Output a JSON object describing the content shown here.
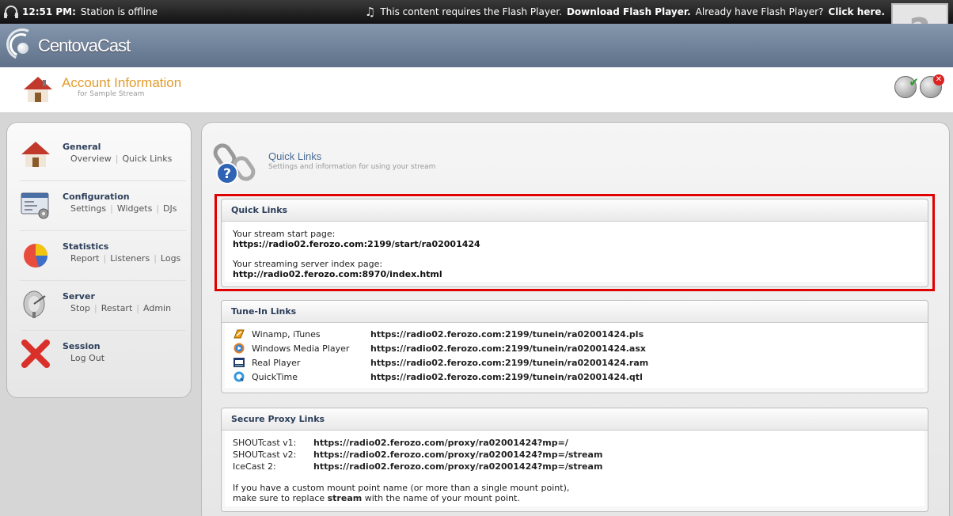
{
  "topbar": {
    "time": "12:51 PM:",
    "status": "Station is offline",
    "flash_notice": "This content requires the Flash Player.",
    "download_link": "Download Flash Player.",
    "already_text": "Already have Flash Player?",
    "click_link": "Click here.",
    "flash_placeholder": "?"
  },
  "brand": {
    "name": "CentovaCast"
  },
  "account": {
    "title": "Account Information",
    "subtitle": "for Sample Stream"
  },
  "sidebar": {
    "sections": [
      {
        "heading": "General",
        "links": [
          "Overview",
          "Quick Links"
        ]
      },
      {
        "heading": "Configuration",
        "links": [
          "Settings",
          "Widgets",
          "DJs"
        ]
      },
      {
        "heading": "Statistics",
        "links": [
          "Report",
          "Listeners",
          "Logs"
        ]
      },
      {
        "heading": "Server",
        "links": [
          "Stop",
          "Restart",
          "Admin"
        ]
      },
      {
        "heading": "Session",
        "links": [
          "Log Out"
        ]
      }
    ]
  },
  "page": {
    "title": "Quick Links",
    "subtitle": "Settings and information for using your stream"
  },
  "quick_links": {
    "heading": "Quick Links",
    "start_label": "Your stream start page:",
    "start_url": "https://radio02.ferozo.com:2199/start/ra02001424",
    "index_label": "Your streaming server index page:",
    "index_url": "http://radio02.ferozo.com:8970/index.html"
  },
  "tunein": {
    "heading": "Tune-In Links",
    "rows": [
      {
        "name": "Winamp, iTunes",
        "url": "https://radio02.ferozo.com:2199/tunein/ra02001424.pls"
      },
      {
        "name": "Windows Media Player",
        "url": "https://radio02.ferozo.com:2199/tunein/ra02001424.asx"
      },
      {
        "name": "Real Player",
        "url": "https://radio02.ferozo.com:2199/tunein/ra02001424.ram"
      },
      {
        "name": "QuickTime",
        "url": "https://radio02.ferozo.com:2199/tunein/ra02001424.qtl"
      }
    ]
  },
  "proxy": {
    "heading": "Secure Proxy Links",
    "rows": [
      {
        "name": "SHOUTcast v1:",
        "url": "https://radio02.ferozo.com/proxy/ra02001424?mp=/"
      },
      {
        "name": "SHOUTcast v2:",
        "url": "https://radio02.ferozo.com/proxy/ra02001424?mp=/stream"
      },
      {
        "name": "IceCast 2:",
        "url": "https://radio02.ferozo.com/proxy/ra02001424?mp=/stream"
      }
    ],
    "note_line1": "If you have a custom mount point name (or more than a single mount point),",
    "note_pre": "make sure to replace ",
    "note_bold": "stream",
    "note_post": " with the name of your mount point."
  },
  "colors": {
    "accent_orange": "#e39b2c",
    "heading_blue": "#2c3e5a",
    "highlight_red": "#e00000"
  }
}
